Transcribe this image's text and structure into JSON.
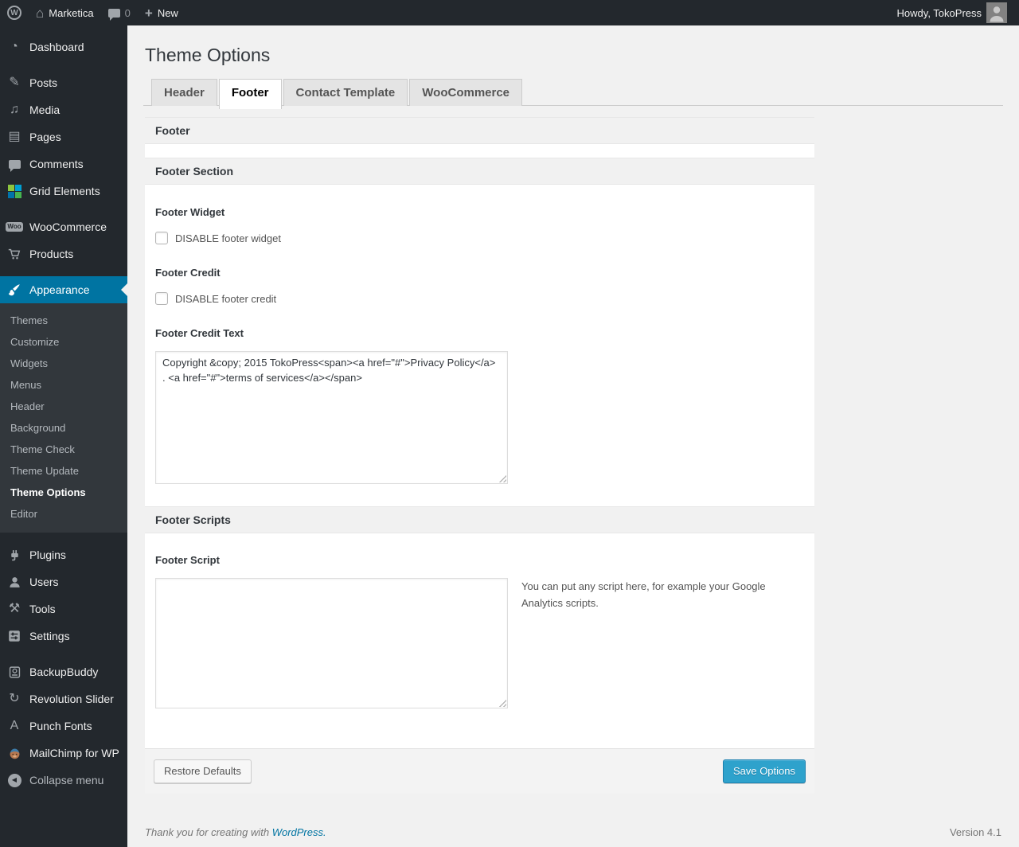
{
  "admin_bar": {
    "wp_logo": "W",
    "home_glyph": "⌂",
    "site_name": "Marketica",
    "comment_count": "0",
    "plus_glyph": "+",
    "new_label": "New",
    "howdy_text": "Howdy, TokoPress"
  },
  "sidebar": {
    "main": [
      {
        "label": "Dashboard"
      },
      {
        "label": "Posts"
      },
      {
        "label": "Media"
      },
      {
        "label": "Pages"
      },
      {
        "label": "Comments"
      },
      {
        "label": "Grid Elements"
      }
    ],
    "shop": [
      {
        "label": "WooCommerce"
      },
      {
        "label": "Products"
      }
    ],
    "appearance": {
      "label": "Appearance",
      "submenu": [
        "Themes",
        "Customize",
        "Widgets",
        "Menus",
        "Header",
        "Background",
        "Theme Check",
        "Theme Update",
        "Theme Options",
        "Editor"
      ],
      "current_submenu": "Theme Options"
    },
    "manage": [
      {
        "label": "Plugins"
      },
      {
        "label": "Users"
      },
      {
        "label": "Tools"
      },
      {
        "label": "Settings"
      }
    ],
    "plugins_extra": [
      {
        "label": "BackupBuddy"
      },
      {
        "label": "Revolution Slider"
      },
      {
        "label": "Punch Fonts"
      },
      {
        "label": "MailChimp for WP"
      }
    ],
    "collapse_label": "Collapse menu"
  },
  "icons": {
    "dashboard": "◔",
    "posts": "✎",
    "media": "♫",
    "pages": "▤",
    "tools": "⚒",
    "revolution": "↻",
    "punch": "A",
    "woo_badge": "Woo",
    "collapse": "◀"
  },
  "page": {
    "title": "Theme Options",
    "tabs": [
      {
        "label": "Header",
        "active": false
      },
      {
        "label": "Footer",
        "active": true
      },
      {
        "label": "Contact Template",
        "active": false
      },
      {
        "label": "WooCommerce",
        "active": false
      }
    ]
  },
  "panel": {
    "header_title": "Footer",
    "section1_title": "Footer Section",
    "footer_widget_label": "Footer Widget",
    "footer_widget_checkbox_label": "DISABLE footer widget",
    "footer_credit_label": "Footer Credit",
    "footer_credit_checkbox_label": "DISABLE footer credit",
    "footer_credit_text_label": "Footer Credit Text",
    "footer_credit_text_value": "Copyright &copy; 2015 TokoPress<span><a href=\"#\">Privacy Policy</a> . <a href=\"#\">terms of services</a></span>",
    "section2_title": "Footer Scripts",
    "footer_script_label": "Footer Script",
    "footer_script_value": "",
    "footer_script_help": "You can put any script here, for example your Google Analytics scripts.",
    "restore_button": "Restore Defaults",
    "save_button": "Save Options"
  },
  "page_footer": {
    "thanks_prefix": "Thank you for creating with ",
    "wordpress_link": "WordPress.",
    "version": "Version 4.1"
  },
  "colors": {
    "accent_blue": "#0074a2",
    "primary_button": "#2ea2cc",
    "admin_bar_bg": "#23282d",
    "sidebar_bg": "#23282d",
    "body_bg": "#f1f1f1"
  }
}
